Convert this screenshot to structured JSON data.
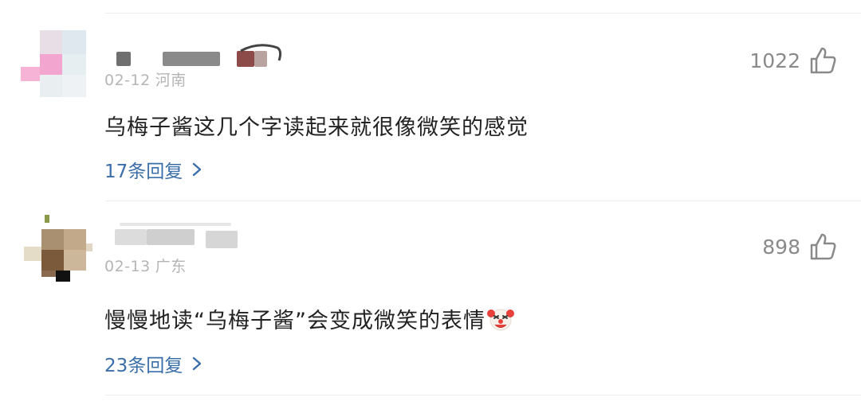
{
  "comments": [
    {
      "date": "02-12",
      "location": "河南",
      "likes": "1022",
      "text": "乌梅子酱这几个字读起来就很像微笑的感觉",
      "replies": "17条回复"
    },
    {
      "date": "02-13",
      "location": "广东",
      "likes": "898",
      "text": "慢慢地读“乌梅子酱”会变成微笑的表情",
      "replies": "23条回复",
      "emoji": "clown-face-emoji"
    }
  ],
  "icons": {
    "like": "thumbs-up-outline-icon",
    "replies_chevron": "chevron-right-icon"
  },
  "colors": {
    "link": "#3a6ea8",
    "meta": "#b5b5b5",
    "text": "#222222",
    "likes": "#8a8a8a"
  }
}
